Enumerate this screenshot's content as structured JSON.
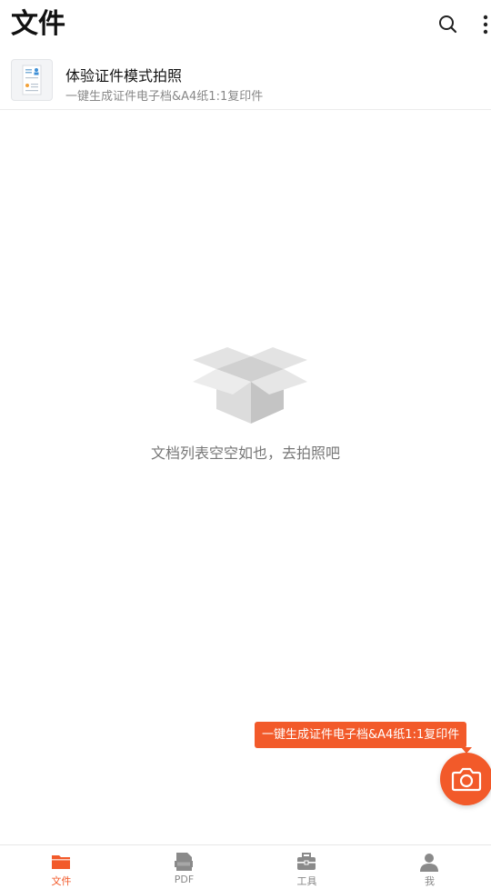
{
  "header": {
    "title": "文件"
  },
  "promo": {
    "title": "体验证件模式拍照",
    "subtitle": "一键生成证件电子档&A4纸1:1复印件"
  },
  "empty_state": {
    "message": "文档列表空空如也，去拍照吧"
  },
  "tooltip": {
    "text": "一键生成证件电子档&A4纸1:1复印件"
  },
  "bottom_nav": {
    "items": [
      {
        "label": "文件",
        "icon": "folder-icon",
        "active": true
      },
      {
        "label": "PDF",
        "icon": "pdf-icon",
        "active": false
      },
      {
        "label": "工具",
        "icon": "toolbox-icon",
        "active": false
      },
      {
        "label": "我",
        "icon": "profile-icon",
        "active": false
      }
    ]
  },
  "colors": {
    "accent": "#f25a2a",
    "text_primary": "#111111",
    "text_secondary": "#888888",
    "empty_text": "#777777",
    "nav_inactive": "#888888"
  }
}
